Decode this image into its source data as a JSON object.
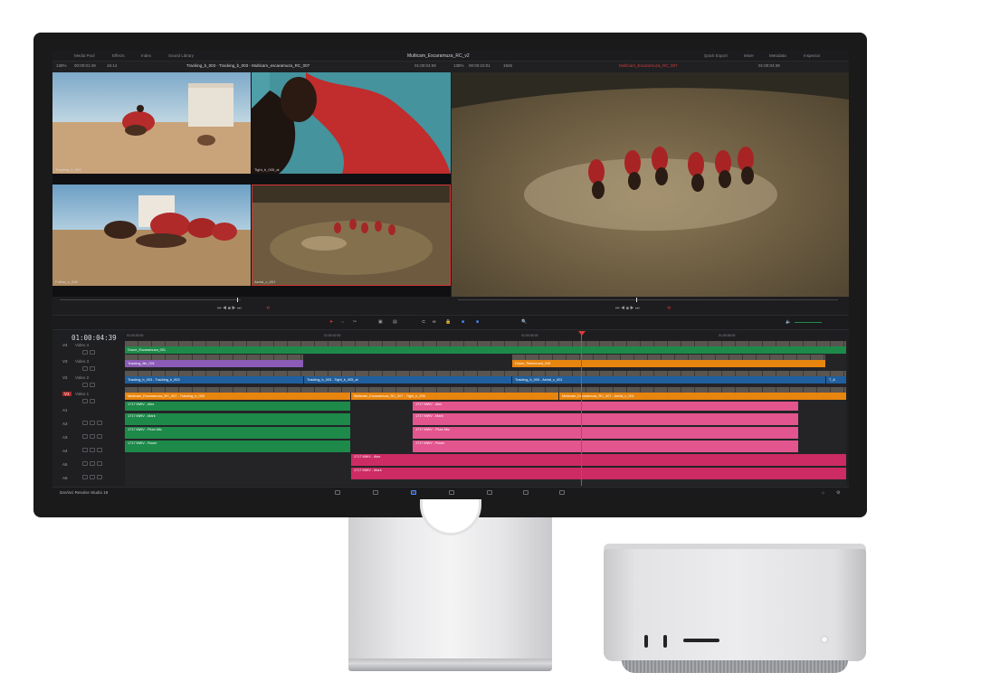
{
  "app": {
    "project_title": "Multicam_Escaramuza_RC_v2",
    "brand": "DaVinci Resolve Studio 19"
  },
  "toolbar": {
    "media_pool": "Media Pool",
    "effects": "Effects",
    "index": "Index",
    "sound_library": "Sound Library",
    "quick_export": "Quick Export",
    "mixer": "Mixer",
    "metadata": "Metadata",
    "inspector": "Inspector"
  },
  "infobar": {
    "zoom_left": "138%",
    "tc_left": "00:00:01:49",
    "left_extra": "16:14",
    "clip_title": "Tracking_b_003 - Tracking_b_003 - Multicam_escaramuza_RC_007",
    "tc_mid": "01:00:04:08",
    "zoom_right": "138%",
    "tc_right": "00:00:10:01",
    "right_extra": "1926",
    "right_title": "Multicam_Escaramuza_RC_007",
    "tc_far": "01:00:04:39"
  },
  "viewer": {
    "angles": [
      {
        "label": "Tracking_b_003"
      },
      {
        "label": "Tight_b_005_al"
      },
      {
        "label": "Follow_c_008"
      },
      {
        "label": "Aerial_c_001"
      }
    ]
  },
  "timeline": {
    "timecode": "01:00:04:39",
    "ruler": [
      "01:00:00:00",
      "01:00:02:00",
      "01:00:04:00",
      "01:00:06:00"
    ],
    "tracks": [
      {
        "name": "V4",
        "label": "Video 4"
      },
      {
        "name": "V3",
        "label": "Video 3"
      },
      {
        "name": "V2",
        "label": "Video 2"
      },
      {
        "name": "V1",
        "label": "Video 1"
      },
      {
        "name": "A1",
        "label": ""
      },
      {
        "name": "A2",
        "label": ""
      },
      {
        "name": "A3",
        "label": ""
      },
      {
        "name": "A4",
        "label": ""
      },
      {
        "name": "A5",
        "label": ""
      },
      {
        "name": "A6",
        "label": ""
      }
    ],
    "clips": {
      "v4": "Drone_Escaramuza_001",
      "v3a": "Tracking_file_001",
      "v3b": "Drone_Reinforced_008",
      "v2a": "Tracking_b_003 - Tracking_b_003",
      "v2b": "Tracking_b_003 - Tight_b_005_al",
      "v2c": "Tracking_b_003 - Aerial_c_001",
      "v2d": "T_A",
      "v1a": "Multicam_Escaramuza_RC_007 - Tracking_b_003",
      "v1b": "Multicam_Escaramuza_RC_007 - Tight_b_005",
      "v1c": "Multicam_Escaramuza_RC_007 - Aerial_c_001",
      "a1a": "1717 MWV - Alex",
      "a1b": "1717 MWV - Alex",
      "a2a": "1717 MWV - Mark",
      "a2b": "1717 MWV - Mark",
      "a3a": "1717 MWV - Plum Mic",
      "a3b": "1717 MWV - Plum Mic",
      "a4a": "1717 MWV - Room",
      "a4b": "1717 MWV - Room",
      "a5": "1717 MWV - Alex",
      "a6": "1717 MWV - Mark"
    }
  },
  "colors": {
    "green_clip": "#1d8a4a",
    "purple_clip": "#8a5bb7",
    "orange_clip": "#e8850f",
    "blue_clip": "#1f5f9e",
    "pink_clip": "#e2558e",
    "magenta_clip": "#cc2b63",
    "playhead": "#e03a3a"
  }
}
